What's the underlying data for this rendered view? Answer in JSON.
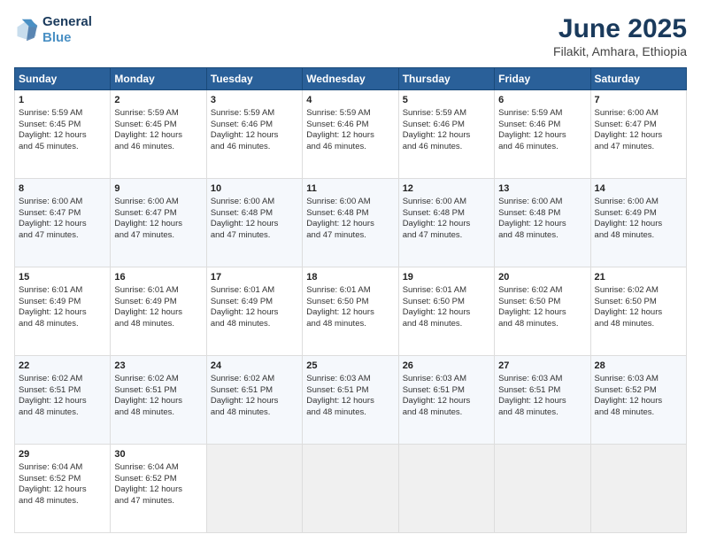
{
  "header": {
    "logo_line1": "General",
    "logo_line2": "Blue",
    "main_title": "June 2025",
    "subtitle": "Filakit, Amhara, Ethiopia"
  },
  "days_of_week": [
    "Sunday",
    "Monday",
    "Tuesday",
    "Wednesday",
    "Thursday",
    "Friday",
    "Saturday"
  ],
  "weeks": [
    [
      {
        "day": "1",
        "info": "Sunrise: 5:59 AM\nSunset: 6:45 PM\nDaylight: 12 hours\nand 45 minutes."
      },
      {
        "day": "2",
        "info": "Sunrise: 5:59 AM\nSunset: 6:45 PM\nDaylight: 12 hours\nand 46 minutes."
      },
      {
        "day": "3",
        "info": "Sunrise: 5:59 AM\nSunset: 6:46 PM\nDaylight: 12 hours\nand 46 minutes."
      },
      {
        "day": "4",
        "info": "Sunrise: 5:59 AM\nSunset: 6:46 PM\nDaylight: 12 hours\nand 46 minutes."
      },
      {
        "day": "5",
        "info": "Sunrise: 5:59 AM\nSunset: 6:46 PM\nDaylight: 12 hours\nand 46 minutes."
      },
      {
        "day": "6",
        "info": "Sunrise: 5:59 AM\nSunset: 6:46 PM\nDaylight: 12 hours\nand 46 minutes."
      },
      {
        "day": "7",
        "info": "Sunrise: 6:00 AM\nSunset: 6:47 PM\nDaylight: 12 hours\nand 47 minutes."
      }
    ],
    [
      {
        "day": "8",
        "info": "Sunrise: 6:00 AM\nSunset: 6:47 PM\nDaylight: 12 hours\nand 47 minutes."
      },
      {
        "day": "9",
        "info": "Sunrise: 6:00 AM\nSunset: 6:47 PM\nDaylight: 12 hours\nand 47 minutes."
      },
      {
        "day": "10",
        "info": "Sunrise: 6:00 AM\nSunset: 6:48 PM\nDaylight: 12 hours\nand 47 minutes."
      },
      {
        "day": "11",
        "info": "Sunrise: 6:00 AM\nSunset: 6:48 PM\nDaylight: 12 hours\nand 47 minutes."
      },
      {
        "day": "12",
        "info": "Sunrise: 6:00 AM\nSunset: 6:48 PM\nDaylight: 12 hours\nand 47 minutes."
      },
      {
        "day": "13",
        "info": "Sunrise: 6:00 AM\nSunset: 6:48 PM\nDaylight: 12 hours\nand 48 minutes."
      },
      {
        "day": "14",
        "info": "Sunrise: 6:00 AM\nSunset: 6:49 PM\nDaylight: 12 hours\nand 48 minutes."
      }
    ],
    [
      {
        "day": "15",
        "info": "Sunrise: 6:01 AM\nSunset: 6:49 PM\nDaylight: 12 hours\nand 48 minutes."
      },
      {
        "day": "16",
        "info": "Sunrise: 6:01 AM\nSunset: 6:49 PM\nDaylight: 12 hours\nand 48 minutes."
      },
      {
        "day": "17",
        "info": "Sunrise: 6:01 AM\nSunset: 6:49 PM\nDaylight: 12 hours\nand 48 minutes."
      },
      {
        "day": "18",
        "info": "Sunrise: 6:01 AM\nSunset: 6:50 PM\nDaylight: 12 hours\nand 48 minutes."
      },
      {
        "day": "19",
        "info": "Sunrise: 6:01 AM\nSunset: 6:50 PM\nDaylight: 12 hours\nand 48 minutes."
      },
      {
        "day": "20",
        "info": "Sunrise: 6:02 AM\nSunset: 6:50 PM\nDaylight: 12 hours\nand 48 minutes."
      },
      {
        "day": "21",
        "info": "Sunrise: 6:02 AM\nSunset: 6:50 PM\nDaylight: 12 hours\nand 48 minutes."
      }
    ],
    [
      {
        "day": "22",
        "info": "Sunrise: 6:02 AM\nSunset: 6:51 PM\nDaylight: 12 hours\nand 48 minutes."
      },
      {
        "day": "23",
        "info": "Sunrise: 6:02 AM\nSunset: 6:51 PM\nDaylight: 12 hours\nand 48 minutes."
      },
      {
        "day": "24",
        "info": "Sunrise: 6:02 AM\nSunset: 6:51 PM\nDaylight: 12 hours\nand 48 minutes."
      },
      {
        "day": "25",
        "info": "Sunrise: 6:03 AM\nSunset: 6:51 PM\nDaylight: 12 hours\nand 48 minutes."
      },
      {
        "day": "26",
        "info": "Sunrise: 6:03 AM\nSunset: 6:51 PM\nDaylight: 12 hours\nand 48 minutes."
      },
      {
        "day": "27",
        "info": "Sunrise: 6:03 AM\nSunset: 6:51 PM\nDaylight: 12 hours\nand 48 minutes."
      },
      {
        "day": "28",
        "info": "Sunrise: 6:03 AM\nSunset: 6:52 PM\nDaylight: 12 hours\nand 48 minutes."
      }
    ],
    [
      {
        "day": "29",
        "info": "Sunrise: 6:04 AM\nSunset: 6:52 PM\nDaylight: 12 hours\nand 48 minutes."
      },
      {
        "day": "30",
        "info": "Sunrise: 6:04 AM\nSunset: 6:52 PM\nDaylight: 12 hours\nand 47 minutes."
      },
      {
        "day": "",
        "info": ""
      },
      {
        "day": "",
        "info": ""
      },
      {
        "day": "",
        "info": ""
      },
      {
        "day": "",
        "info": ""
      },
      {
        "day": "",
        "info": ""
      }
    ]
  ]
}
